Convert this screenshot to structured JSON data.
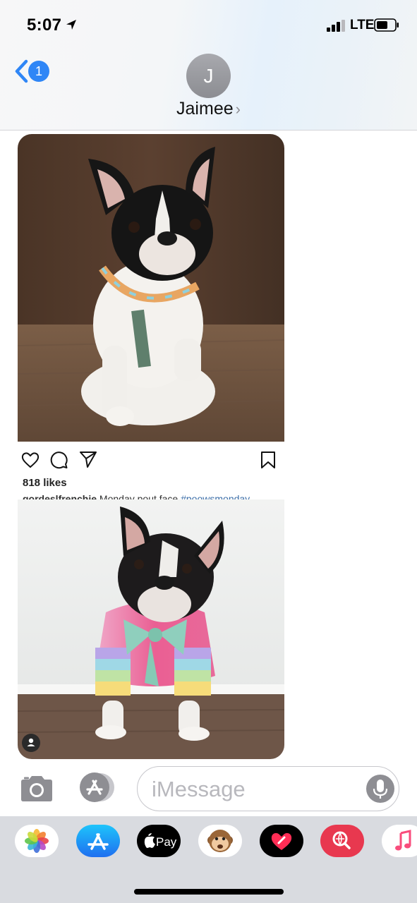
{
  "status_bar": {
    "time": "5:07",
    "network": "LTE"
  },
  "nav": {
    "back_count": "1",
    "avatar_initial": "J",
    "contact_name": "Jaimee",
    "contact_chevron": "›"
  },
  "post1": {
    "likes": "818 likes",
    "caption_handle": "gordeslfrenchie",
    "caption_text": " Monday pout face ",
    "caption_tag": "#poowsmonday"
  },
  "composer": {
    "placeholder": "iMessage"
  },
  "app_drawer": {
    "apps": [
      {
        "name": "photos-app-icon"
      },
      {
        "name": "app-store-app-icon"
      },
      {
        "name": "apple-pay-app-icon",
        "label": "Pay"
      },
      {
        "name": "animoji-app-icon"
      },
      {
        "name": "digital-touch-app-icon"
      },
      {
        "name": "web-search-app-icon"
      },
      {
        "name": "music-app-icon"
      }
    ]
  },
  "colors": {
    "accent": "#2f86f6",
    "avatar_gray": "#9a9ba0",
    "drawer_bg": "#d9dbe0"
  }
}
